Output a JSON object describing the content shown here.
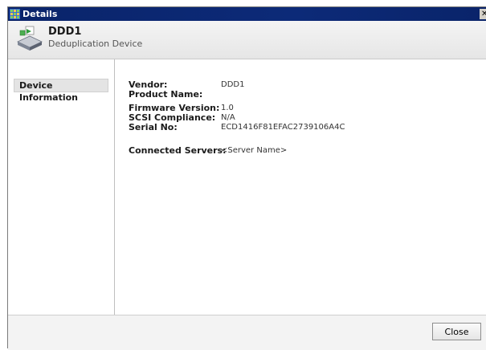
{
  "window": {
    "title": "Details",
    "close_glyph": "✕",
    "title_icon": "grid-app-icon",
    "titlebar_color": "#0a246a"
  },
  "header": {
    "device_name": "DDD1",
    "device_type": "Deduplication Device",
    "icon": "deduplication-device-icon"
  },
  "nav": {
    "items": [
      {
        "label": "Device Information",
        "selected": true
      }
    ]
  },
  "device_info": {
    "fields": [
      {
        "label": "Vendor:",
        "value": "DDD1"
      },
      {
        "label": "Product Name:",
        "value": ""
      },
      {
        "label": "Firmware Version:",
        "value": "1.0"
      },
      {
        "label": "SCSI Compliance:",
        "value": "N/A"
      },
      {
        "label": "Serial No:",
        "value": "ECD1416F81EFAC2739106A4C"
      }
    ],
    "connected_servers": {
      "label": "Connected Servers:",
      "value": "<Server Name>"
    }
  },
  "footer": {
    "close_label": "Close"
  }
}
